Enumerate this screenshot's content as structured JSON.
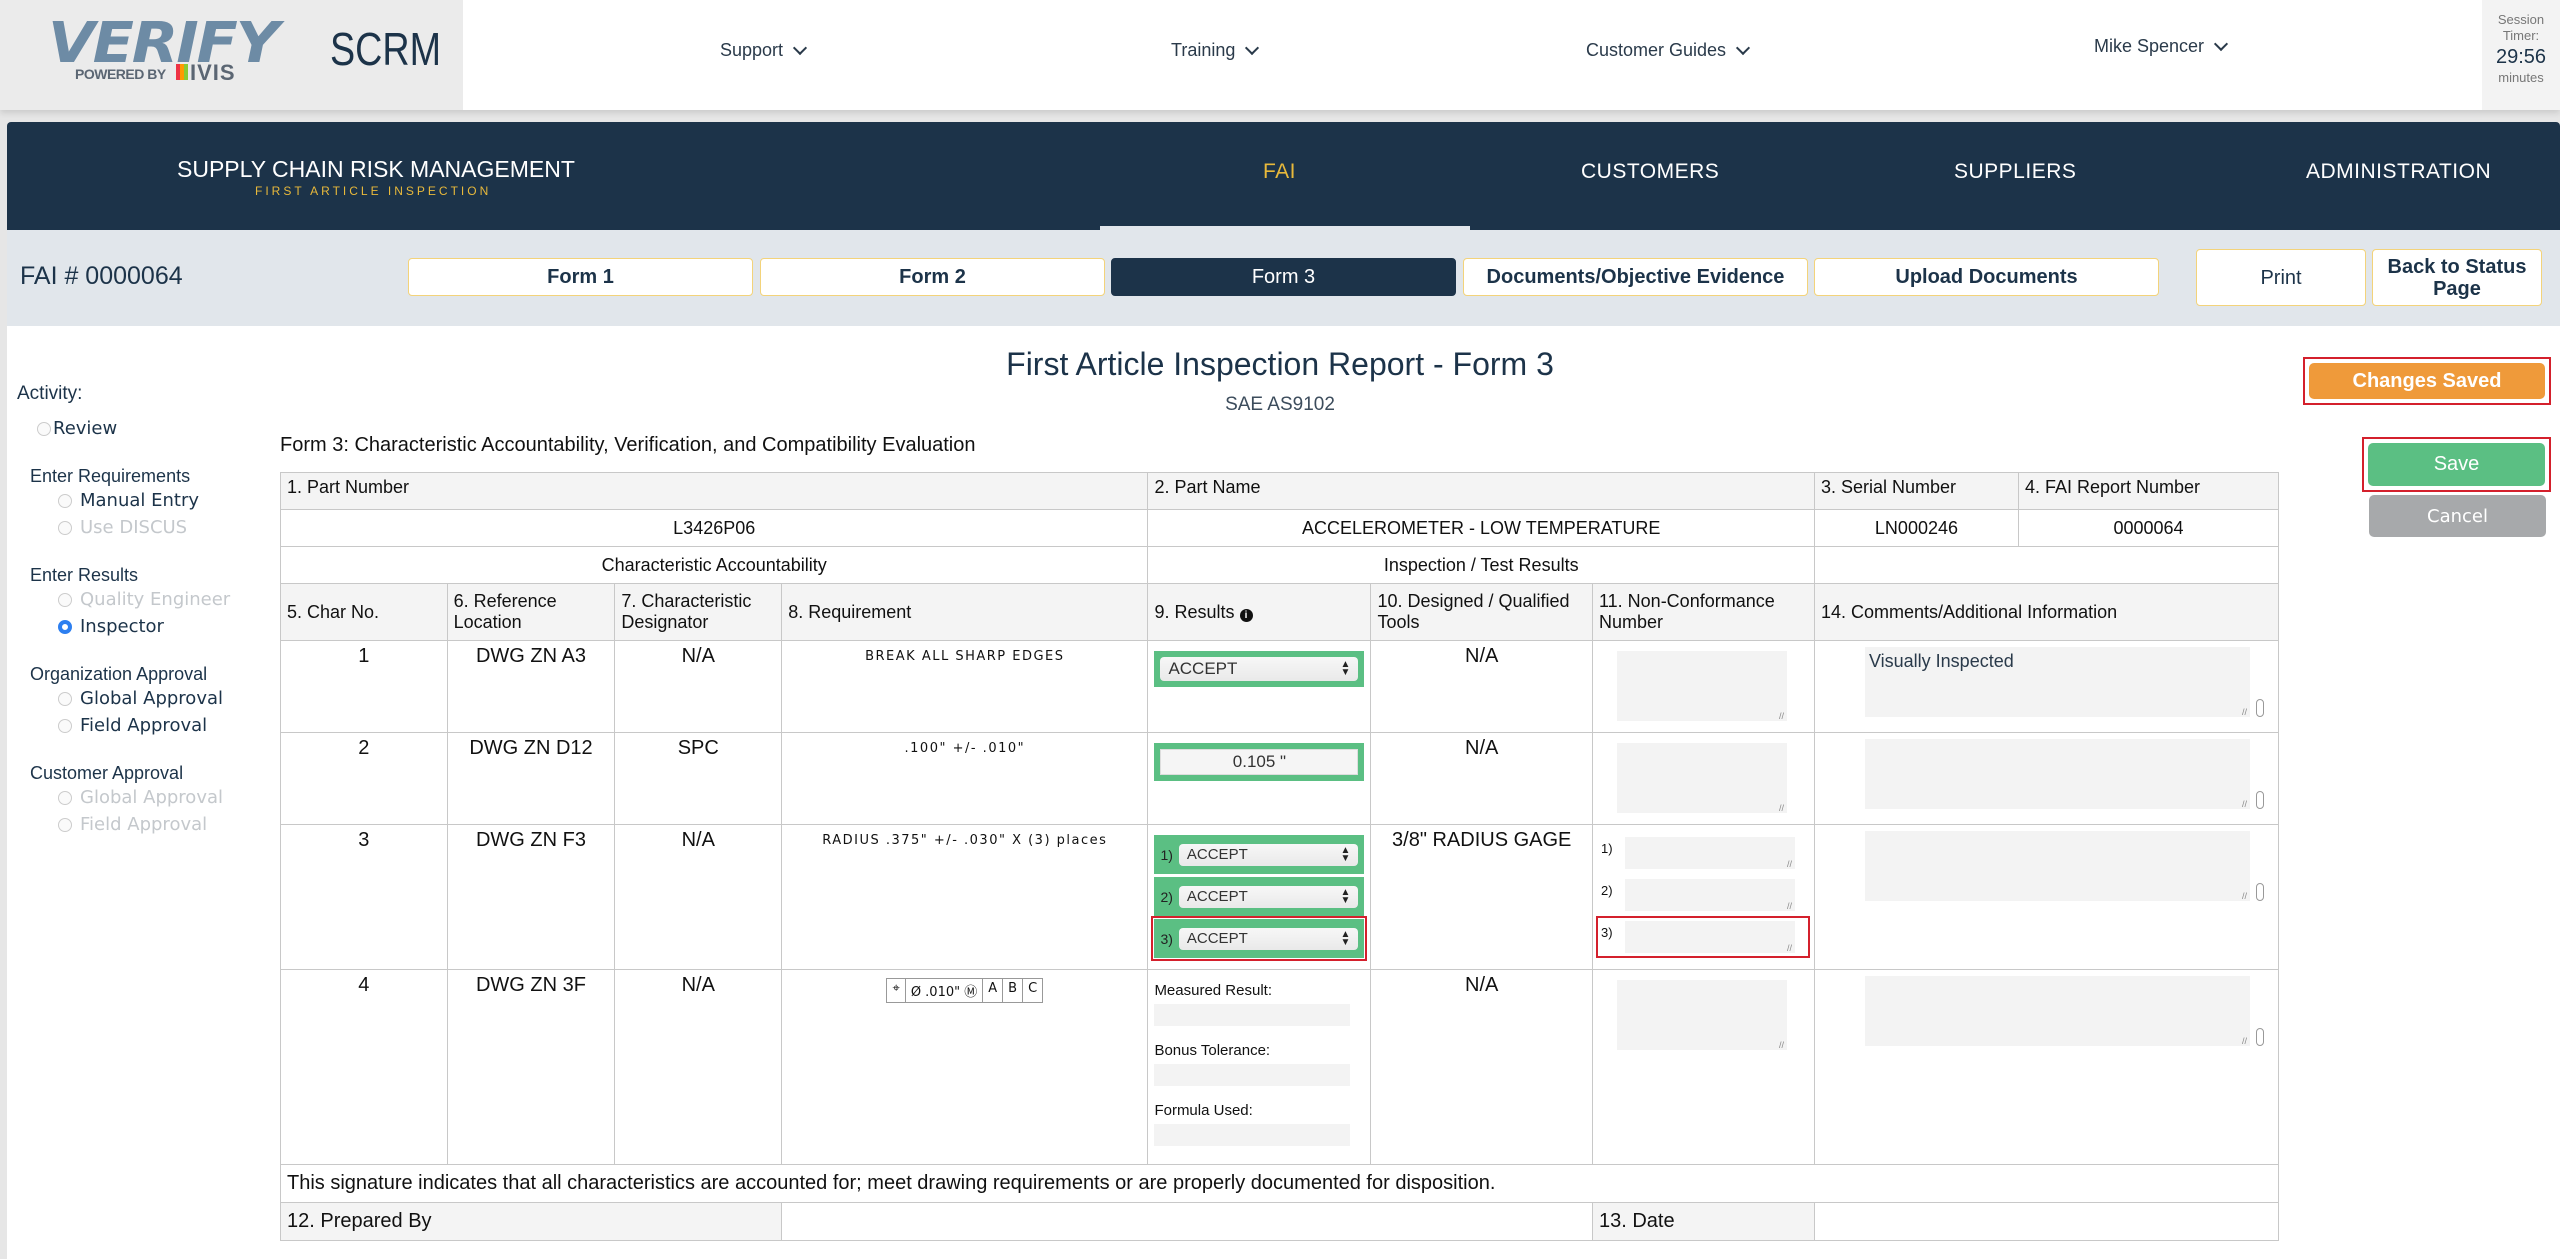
{
  "header": {
    "logo_text": "VERIFY",
    "logo_powered": "POWERED BY",
    "logo_ivis": "IVIS",
    "app_name": "SCRM",
    "nav": [
      {
        "label": "Support"
      },
      {
        "label": "Training"
      },
      {
        "label": "Customer Guides"
      }
    ],
    "user": "Mike Spencer",
    "session": {
      "label1": "Session",
      "label2": "Timer:",
      "time": "29:56",
      "unit": "minutes"
    }
  },
  "mainnav": {
    "brand_title": "SUPPLY CHAIN RISK MANAGEMENT",
    "brand_sub": "FIRST ARTICLE INSPECTION",
    "items": [
      {
        "label": "FAI",
        "active": true
      },
      {
        "label": "CUSTOMERS"
      },
      {
        "label": "SUPPLIERS"
      },
      {
        "label": "ADMINISTRATION"
      }
    ]
  },
  "formbar": {
    "fai_number": "FAI # 0000064",
    "tabs": [
      {
        "label": "Form 1"
      },
      {
        "label": "Form 2"
      },
      {
        "label": "Form 3",
        "active": true
      },
      {
        "label": "Documents/Objective Evidence"
      },
      {
        "label": "Upload Documents"
      }
    ],
    "print": "Print",
    "back": "Back to Status Page"
  },
  "sidebar": {
    "activity_label": "Activity:",
    "review": "Review",
    "groups": [
      {
        "title": "Enter Requirements",
        "options": [
          {
            "label": "Manual Entry",
            "state": "enabled"
          },
          {
            "label": "Use DISCUS",
            "state": "disabled"
          }
        ]
      },
      {
        "title": "Enter Results",
        "options": [
          {
            "label": "Quality Engineer",
            "state": "disabled"
          },
          {
            "label": "Inspector",
            "state": "checked"
          }
        ]
      },
      {
        "title": "Organization Approval",
        "options": [
          {
            "label": "Global Approval",
            "state": "enabled"
          },
          {
            "label": "Field Approval",
            "state": "enabled"
          }
        ]
      },
      {
        "title": "Customer Approval",
        "options": [
          {
            "label": "Global Approval",
            "state": "disabled"
          },
          {
            "label": "Field Approval",
            "state": "disabled"
          }
        ]
      }
    ]
  },
  "report": {
    "title": "First Article Inspection Report - Form 3",
    "subtitle": "SAE AS9102",
    "heading": "Form 3: Characteristic Accountability, Verification, and Compatibility Evaluation"
  },
  "actions": {
    "status": "Changes Saved",
    "save": "Save",
    "cancel": "Cancel"
  },
  "colors": {
    "navy": "#1c3349",
    "gold": "#e8b93b",
    "green": "#5bbf83",
    "orange": "#ef9a3a",
    "highlight_red": "#d4202c"
  },
  "table": {
    "h_part_number": "1. Part Number",
    "h_part_name": "2. Part Name",
    "h_serial": "3. Serial Number",
    "h_fai_report": "4. FAI Report Number",
    "part_number": "L3426P06",
    "part_name": "ACCELEROMETER - LOW TEMPERATURE",
    "serial": "LN000246",
    "fai_report": "0000064",
    "section_char": "Characteristic Accountability",
    "section_insp": "Inspection / Test Results",
    "cols": {
      "char_no": "5. Char No.",
      "ref_loc": "6. Reference Location",
      "designator": "7. Characteristic Designator",
      "requirement": "8. Requirement",
      "results": "9. Results",
      "tools": "10. Designed / Qualified Tools",
      "nc": "11. Non-Conformance Number",
      "comments": "14. Comments/Additional Information"
    },
    "rows": [
      {
        "no": "1",
        "ref": "DWG ZN A3",
        "designator": "N/A",
        "requirement": "BREAK ALL SHARP EDGES",
        "result": "ACCEPT",
        "tools": "N/A",
        "comment": "Visually Inspected"
      },
      {
        "no": "2",
        "ref": "DWG ZN D12",
        "designator": "SPC",
        "requirement": ".100\" +/- .010\"",
        "result": "0.105 \"",
        "tools": "N/A",
        "comment": ""
      },
      {
        "no": "3",
        "ref": "DWG ZN F3",
        "designator": "N/A",
        "requirement": "RADIUS .375\" +/- .030\" X (3) places",
        "results": [
          {
            "n": "1)",
            "v": "ACCEPT"
          },
          {
            "n": "2)",
            "v": "ACCEPT"
          },
          {
            "n": "3)",
            "v": "ACCEPT"
          }
        ],
        "tools": "3/8\" RADIUS GAGE",
        "nc": [
          "1)",
          "2)",
          "3)"
        ],
        "comment": ""
      },
      {
        "no": "4",
        "ref": "DWG ZN 3F",
        "designator": "N/A",
        "fcf": [
          "⌖",
          "Ø .010\" Ⓜ",
          "A",
          "B",
          "C"
        ],
        "measured_label": "Measured Result:",
        "bonus_label": "Bonus Tolerance:",
        "formula_label": "Formula Used:",
        "tools": "N/A",
        "comment": ""
      }
    ],
    "signature_note": "This signature indicates that all characteristics are accounted for; meet drawing requirements or are properly documented for disposition.",
    "prepared_by": "12. Prepared By",
    "date": "13. Date"
  }
}
